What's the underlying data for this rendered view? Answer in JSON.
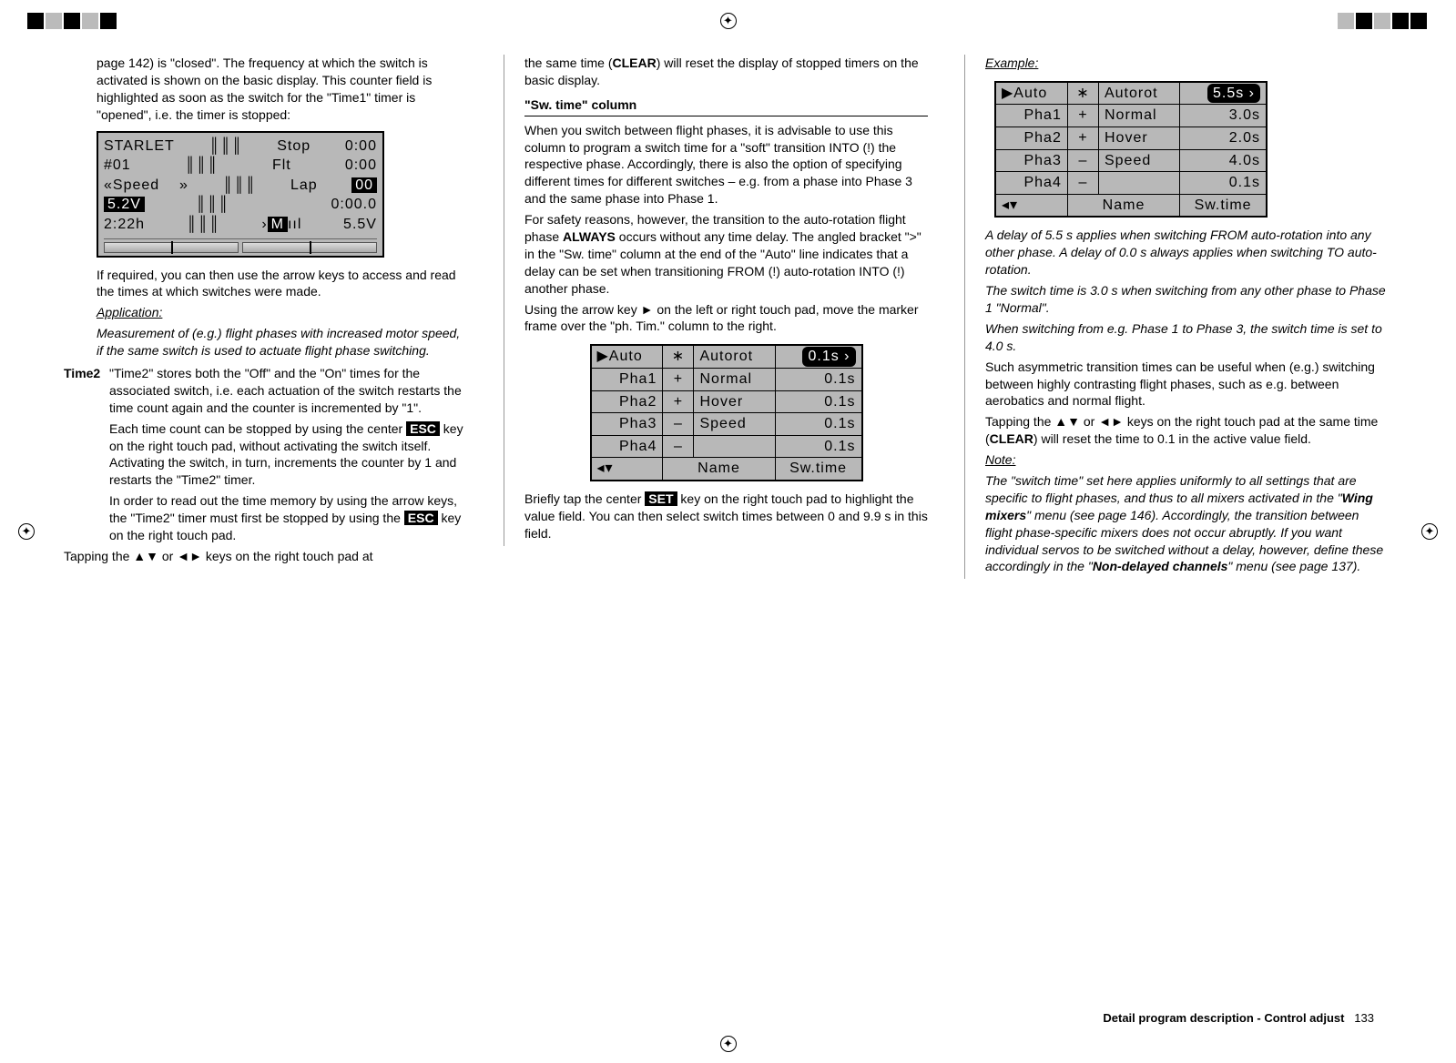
{
  "col1": {
    "p1": "page 142) is \"closed\". The frequency at which the switch is activated is shown on the basic display. This counter field is highlighted as soon as the switch for the \"Time1\" timer is \"opened\", i.e. the timer is stopped:",
    "lcd": {
      "name": "STARLET",
      "model": "#01",
      "speed_l": "«Speed    »",
      "speed_v": "5.2V",
      "time_l": "2:22h",
      "stop_l": "Stop",
      "stop_v": "0:00",
      "flt_l": "Flt",
      "flt_v": "0:00",
      "lap_l": "Lap",
      "lap_v": "00",
      "lap_t": "0:00.0",
      "m_l": "M",
      "m_v": "5.5V"
    },
    "p2": "If required, you can then use the arrow keys to access and read the times at which switches were made.",
    "app_head": "Application:",
    "app_body": "Measurement of (e.g.) flight phases with increased motor speed, if the same switch is used to actuate flight phase switching.",
    "time2_label": "Time2",
    "time2_p1": "\"Time2\" stores both the \"Off\" and the \"On\" times for the associated switch, i.e. each actuation of the switch restarts the time count again and the counter is incremented by \"1\".",
    "time2_p2a": "Each time count can be stopped by using the center ",
    "esc": "ESC",
    "time2_p2b": " key on the right touch pad, without activating the switch itself. Activating the switch, in turn, increments the counter by 1 and restarts the \"Time2\" timer.",
    "time2_p3a": "In order to read out the time memory by using the arrow keys, the \"Time2\" timer must first be stopped by using the ",
    "time2_p3b": " key on the right touch pad.",
    "p3": "Tapping the ▲▼ or ◄► keys on the right touch pad at"
  },
  "col2": {
    "p1a": "the same time (",
    "clear": "CLEAR",
    "p1b": ") will reset the display of stopped timers on the basic display.",
    "swhead": "\"Sw. time\" column",
    "p2": "When you switch between flight phases, it is advisable to use this column to program a switch time for a \"soft\" transition INTO (!) the respective phase. Accordingly, there is also the option of specifying different times for different switches – e.g. from a phase into Phase 3 and the same phase into Phase 1.",
    "p3a": "For safety reasons, however, the transition to the auto-rotation flight phase ",
    "always": "ALWAYS",
    "p3b": " occurs without any time delay. The angled bracket \">\" in the \"Sw. time\" column at the end of the \"Auto\" line indicates that a delay can be set when transitioning FROM (!) auto-rotation INTO (!) another phase.",
    "p4": "Using the arrow key ► on the left or right touch pad, move the marker frame over the \"ph. Tim.\" column to the right.",
    "table1": {
      "rows": [
        {
          "ph": "▶Auto",
          "sw": "∗",
          "name": "Autorot",
          "t": "0.1s ›",
          "sel": true
        },
        {
          "ph": "Pha1",
          "sw": "+",
          "name": "Normal",
          "t": "0.1s"
        },
        {
          "ph": "Pha2",
          "sw": "+",
          "name": "Hover",
          "t": "0.1s"
        },
        {
          "ph": "Pha3",
          "sw": "–",
          "name": "Speed",
          "t": "0.1s"
        },
        {
          "ph": "Pha4",
          "sw": "–",
          "name": "",
          "t": "0.1s"
        }
      ],
      "foot_l": "◂▾",
      "foot_c": "Name",
      "foot_r": "Sw.time"
    },
    "p5a": "Briefly tap the center ",
    "set": "SET",
    "p5b": " key on the right touch pad to highlight the value field. You can then select switch times between 0 and 9.9 s in this field."
  },
  "col3": {
    "ex": "Example:",
    "table2": {
      "rows": [
        {
          "ph": "▶Auto",
          "sw": "∗",
          "name": "Autorot",
          "t": "5.5s ›",
          "sel": true
        },
        {
          "ph": "Pha1",
          "sw": "+",
          "name": "Normal",
          "t": "3.0s"
        },
        {
          "ph": "Pha2",
          "sw": "+",
          "name": "Hover",
          "t": "2.0s"
        },
        {
          "ph": "Pha3",
          "sw": "–",
          "name": "Speed",
          "t": "4.0s"
        },
        {
          "ph": "Pha4",
          "sw": "–",
          "name": "",
          "t": "0.1s"
        }
      ],
      "foot_l": "◂▾",
      "foot_c": "Name",
      "foot_r": "Sw.time"
    },
    "p1": "A delay of 5.5 s applies when switching FROM auto-rotation into any other phase. A delay of 0.0 s always applies when switching TO auto-rotation.",
    "p2": "The switch time is 3.0 s when switching from any other phase to Phase 1 \"Normal\".",
    "p3": "When switching from e.g. Phase 1 to Phase 3, the switch time is set to 4.0 s.",
    "p4": "Such asymmetric transition times can be useful when (e.g.) switching between highly contrasting flight phases, such as e.g. between aerobatics and normal flight.",
    "p5a": "Tapping the ▲▼ or ◄► keys on the right touch pad at the same time (",
    "clear": "CLEAR",
    "p5b": ") will reset the time to 0.1 in the active value field.",
    "note_head": "Note:",
    "note_a": "The \"switch time\" set here applies uniformly to all settings that are specific to flight phases, and thus to all mixers activated in the \"",
    "wing": "Wing mixers",
    "note_b": "\" menu (see page 146). Accordingly, the transition between flight phase-specific mixers does not occur abruptly. If you want individual servos to be switched without a delay, however, define these accordingly in the \"",
    "nondel": "Non-delayed channels",
    "note_c": "\" menu (see page 137)."
  },
  "footer": {
    "title": "Detail program description - Control adjust",
    "page": "133"
  }
}
